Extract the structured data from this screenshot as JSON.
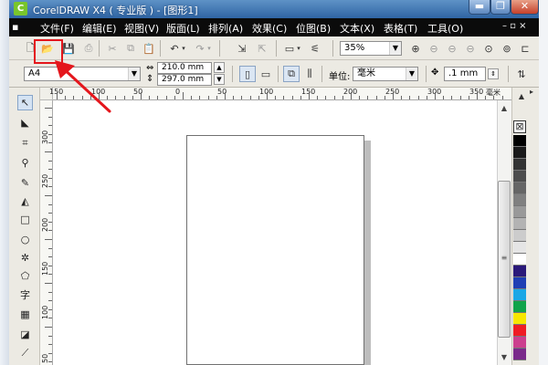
{
  "window": {
    "title": "CorelDRAW X4 ( 专业版 ) - [图形1]",
    "app_icon": "coreldraw-logo-icon",
    "controls": {
      "minimize": "▬",
      "maximize": "❐",
      "close": "✕"
    }
  },
  "menubar": {
    "items": [
      {
        "label": "文件(F)"
      },
      {
        "label": "编辑(E)"
      },
      {
        "label": "视图(V)"
      },
      {
        "label": "版面(L)"
      },
      {
        "label": "排列(A)"
      },
      {
        "label": "效果(C)"
      },
      {
        "label": "位图(B)"
      },
      {
        "label": "文本(X)"
      },
      {
        "label": "表格(T)"
      },
      {
        "label": "工具(O)"
      }
    ],
    "doc_controls": "– ▫ ×"
  },
  "toolbar": {
    "icons": [
      "new-document-icon",
      "open-folder-icon",
      "save-icon",
      "print-icon",
      "cut-icon",
      "copy-icon",
      "paste-icon",
      "undo-icon",
      "redo-icon",
      "import-icon",
      "export-icon",
      "application-launcher-icon",
      "welcome-screen-icon",
      "zoom-in-icon",
      "zoom-out-icon",
      "zoom-fit-icon",
      "zoom-page-icon",
      "snap-icon"
    ],
    "zoom_level": "35%",
    "highlight_color": "#e4161c"
  },
  "property_bar": {
    "paper_size": "A4",
    "width": "210.0 mm",
    "height": "297.0 mm",
    "units_label": "单位:",
    "units_value": "毫米",
    "nudge_value": ".1 mm"
  },
  "ruler": {
    "unit_label": "毫米",
    "h_labels": [
      "150",
      "100",
      "50",
      "0",
      "50",
      "100",
      "150",
      "200",
      "250",
      "300",
      "350"
    ],
    "v_labels": [
      "300",
      "250",
      "200",
      "150",
      "100",
      "50"
    ]
  },
  "toolbox": {
    "tools": [
      {
        "name": "pick-tool-icon",
        "glyph": "↖"
      },
      {
        "name": "shape-tool-icon",
        "glyph": "◣"
      },
      {
        "name": "crop-tool-icon",
        "glyph": "⌗"
      },
      {
        "name": "zoom-tool-icon",
        "glyph": "⚲"
      },
      {
        "name": "freehand-tool-icon",
        "glyph": "✎"
      },
      {
        "name": "smart-fill-icon",
        "glyph": "◭"
      },
      {
        "name": "rectangle-tool-icon",
        "glyph": "□"
      },
      {
        "name": "ellipse-tool-icon",
        "glyph": "○"
      },
      {
        "name": "polygon-tool-icon",
        "glyph": "✲"
      },
      {
        "name": "basic-shapes-icon",
        "glyph": "⬠"
      },
      {
        "name": "text-tool-icon",
        "glyph": "字"
      },
      {
        "name": "table-tool-icon",
        "glyph": "▦"
      },
      {
        "name": "interactive-blend-icon",
        "glyph": "◪"
      },
      {
        "name": "eyedropper-tool-icon",
        "glyph": "⟋"
      }
    ]
  },
  "palette": {
    "colors": [
      "#000000",
      "#1a1a1a",
      "#333333",
      "#4d4d4d",
      "#666666",
      "#808080",
      "#999999",
      "#b3b3b3",
      "#cccccc",
      "#e5e5e5",
      "#ffffff",
      "#2b1a7a",
      "#1f3fb4",
      "#1aa7e6",
      "#11a34a",
      "#f7e600",
      "#ef1c24",
      "#cc3f8e",
      "#7a2a8a"
    ]
  }
}
